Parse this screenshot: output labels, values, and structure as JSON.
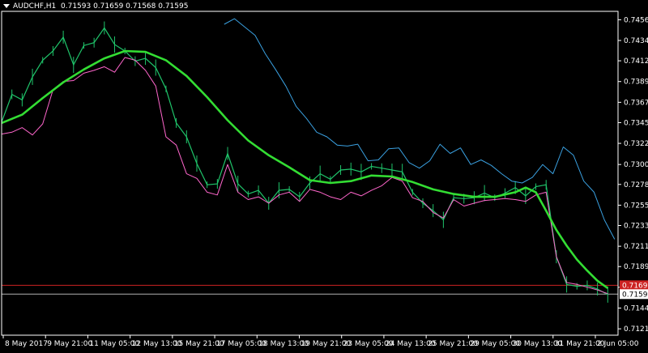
{
  "header": {
    "symbol": "AUDCHF,H1",
    "ohlc": "0.71593 0.71659 0.71568 0.71595"
  },
  "colors": {
    "background": "#000000",
    "frame": "#ffffff",
    "candles": "#1fc46a",
    "bid_line": "#ff66cc",
    "ask_line": "#3aa0e0",
    "moving_average": "#33dd33",
    "alert_line": "#cc2222",
    "price_line": "#b0b0b0"
  },
  "chart_data": {
    "type": "line",
    "title": "AUDCHF,H1",
    "y_ticks": [
      "0.74569",
      "0.74344",
      "0.74124",
      "0.73899",
      "0.73674",
      "0.73454",
      "0.73229",
      "0.73000",
      "0.72784",
      "0.72559",
      "0.72339",
      "0.72114",
      "0.71894",
      "0.71669",
      "0.71444",
      "0.71219"
    ],
    "ylim": [
      0.7115,
      0.7466
    ],
    "x_ticks": [
      "8 May 2017",
      "9 May 21:00",
      "11 May 05:00",
      "12 May 13:00",
      "15 May 21:00",
      "17 May 05:00",
      "18 May 13:00",
      "19 May 21:00",
      "23 May 05:00",
      "24 May 13:00",
      "25 May 21:00",
      "29 May 05:00",
      "30 May 13:00",
      "31 May 21:00",
      "2 Jun 05:00"
    ],
    "price_labels": [
      {
        "name": "alert",
        "value": 0.71691,
        "text": "0.71691"
      },
      {
        "name": "current",
        "value": 0.71595,
        "text": "0.71595"
      }
    ],
    "series": [
      {
        "role": "candles",
        "x": [
          0,
          3,
          6,
          9,
          12,
          15,
          18,
          21,
          24,
          27,
          30,
          33,
          36,
          39,
          42,
          45,
          48,
          51,
          54,
          57,
          60,
          63,
          66,
          69,
          72,
          75,
          78,
          81,
          84,
          87,
          90,
          93,
          96,
          99,
          102,
          105,
          108,
          111,
          114,
          117,
          120,
          123,
          126,
          129,
          132,
          135,
          138,
          141,
          144,
          147,
          150,
          153,
          156,
          159,
          162,
          165,
          168,
          171,
          174,
          177
        ],
        "values": [
          0.7346,
          0.7376,
          0.737,
          0.7395,
          0.7413,
          0.7423,
          0.7438,
          0.7408,
          0.7429,
          0.7432,
          0.7448,
          0.743,
          0.7423,
          0.7412,
          0.7415,
          0.7405,
          0.7382,
          0.7345,
          0.733,
          0.7301,
          0.7278,
          0.7279,
          0.7312,
          0.7279,
          0.7268,
          0.7272,
          0.7258,
          0.7272,
          0.7273,
          0.7265,
          0.728,
          0.729,
          0.7284,
          0.7294,
          0.7295,
          0.7292,
          0.7298,
          0.7296,
          0.7294,
          0.7292,
          0.727,
          0.7258,
          0.725,
          0.724,
          0.7264,
          0.7263,
          0.7264,
          0.7269,
          0.7264,
          0.7269,
          0.7275,
          0.7266,
          0.7276,
          0.7278,
          0.72,
          0.717,
          0.7168,
          0.7169,
          0.7165,
          0.7159
        ]
      },
      {
        "role": "bid",
        "x": [
          0,
          3,
          6,
          9,
          12,
          15,
          18,
          21,
          24,
          27,
          30,
          33,
          36,
          39,
          42,
          45,
          48,
          51,
          54,
          57,
          60,
          63,
          66,
          69,
          72,
          75,
          78,
          81,
          84,
          87,
          90,
          93,
          96,
          99,
          102,
          105,
          108,
          111,
          114,
          117,
          120,
          123,
          126,
          129,
          132,
          135,
          138,
          141,
          144,
          147,
          150,
          153,
          156,
          159,
          162,
          165,
          168,
          171,
          174,
          177
        ],
        "values": [
          0.7333,
          0.7335,
          0.734,
          0.7332,
          0.7344,
          0.7381,
          0.739,
          0.7391,
          0.7399,
          0.7402,
          0.7406,
          0.74,
          0.7416,
          0.7413,
          0.7402,
          0.7385,
          0.733,
          0.7321,
          0.729,
          0.7285,
          0.727,
          0.7267,
          0.73,
          0.727,
          0.7262,
          0.7265,
          0.7258,
          0.7267,
          0.727,
          0.726,
          0.7273,
          0.727,
          0.7265,
          0.7262,
          0.727,
          0.7266,
          0.7272,
          0.7277,
          0.7286,
          0.7282,
          0.7264,
          0.726,
          0.7248,
          0.7242,
          0.7262,
          0.7255,
          0.7258,
          0.7261,
          0.7262,
          0.7263,
          0.7262,
          0.726,
          0.7267,
          0.727,
          0.72,
          0.7172,
          0.717,
          0.7167,
          0.7164,
          0.716
        ]
      },
      {
        "role": "ask",
        "x": [
          65,
          68,
          71,
          74,
          77,
          80,
          83,
          86,
          89,
          92,
          95,
          98,
          101,
          104,
          107,
          110,
          113,
          116,
          119,
          122,
          125,
          128,
          131,
          134,
          137,
          140,
          143,
          146,
          149,
          152,
          155,
          158,
          161,
          164,
          167,
          170,
          173,
          176,
          179
        ],
        "values": [
          0.7452,
          0.7458,
          0.7449,
          0.744,
          0.742,
          0.7403,
          0.7385,
          0.7363,
          0.735,
          0.7335,
          0.733,
          0.7321,
          0.732,
          0.7322,
          0.7304,
          0.7305,
          0.7317,
          0.7318,
          0.7302,
          0.7296,
          0.7304,
          0.7322,
          0.7312,
          0.7318,
          0.73,
          0.7305,
          0.7299,
          0.729,
          0.7282,
          0.728,
          0.7286,
          0.73,
          0.729,
          0.7319,
          0.731,
          0.7282,
          0.727,
          0.724,
          0.7219
        ]
      },
      {
        "role": "moving_average",
        "x": [
          0,
          6,
          12,
          18,
          24,
          30,
          36,
          42,
          48,
          54,
          60,
          66,
          72,
          78,
          84,
          90,
          96,
          102,
          108,
          114,
          120,
          126,
          132,
          138,
          144,
          150,
          153,
          156,
          159,
          162,
          165,
          168,
          171,
          174,
          177
        ],
        "values": [
          0.7345,
          0.7354,
          0.7372,
          0.7389,
          0.7403,
          0.7415,
          0.7423,
          0.7422,
          0.7413,
          0.7396,
          0.7373,
          0.7348,
          0.7326,
          0.731,
          0.7297,
          0.7283,
          0.728,
          0.7282,
          0.7288,
          0.7287,
          0.7281,
          0.7273,
          0.7268,
          0.7265,
          0.7265,
          0.727,
          0.7275,
          0.727,
          0.725,
          0.7229,
          0.7212,
          0.7197,
          0.7185,
          0.7174,
          0.7166
        ]
      }
    ]
  }
}
